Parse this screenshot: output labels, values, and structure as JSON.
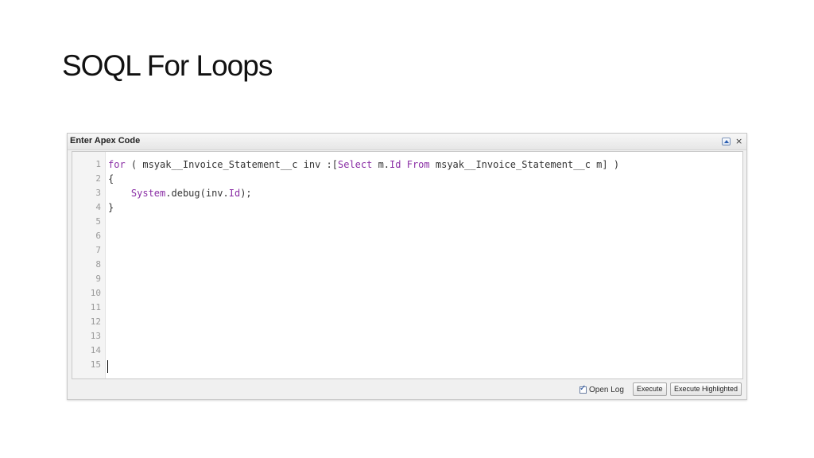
{
  "slide": {
    "title": "SOQL For Loops"
  },
  "panel": {
    "title": "Enter Apex Code",
    "collapse_icon": "collapse-up-icon",
    "close_label": "×"
  },
  "editor": {
    "keyword_color": "#8a2ea5",
    "line_numbers": [
      "1",
      "2",
      "3",
      "4",
      "5",
      "6",
      "7",
      "8",
      "9",
      "10",
      "11",
      "12",
      "13",
      "14",
      "15"
    ],
    "lines": [
      {
        "segments": [
          {
            "text": "for",
            "kw": true
          },
          {
            "text": " ( msyak__Invoice_Statement__c inv :[",
            "kw": false
          },
          {
            "text": "Select",
            "kw": true
          },
          {
            "text": " m.",
            "kw": false
          },
          {
            "text": "Id",
            "kw": true
          },
          {
            "text": " ",
            "kw": false
          },
          {
            "text": "From",
            "kw": true
          },
          {
            "text": " msyak__Invoice_Statement__c m] )",
            "kw": false
          }
        ]
      },
      {
        "segments": [
          {
            "text": "{",
            "kw": false
          }
        ]
      },
      {
        "segments": [
          {
            "text": "    ",
            "kw": false
          },
          {
            "text": "System",
            "kw": true
          },
          {
            "text": ".debug(inv.",
            "kw": false
          },
          {
            "text": "Id",
            "kw": true
          },
          {
            "text": ");",
            "kw": false
          }
        ]
      },
      {
        "segments": [
          {
            "text": "}",
            "kw": false
          }
        ]
      }
    ]
  },
  "footer": {
    "open_log_label": "Open Log",
    "open_log_checked": true,
    "execute_label": "Execute",
    "execute_highlighted_label": "Execute Highlighted"
  }
}
